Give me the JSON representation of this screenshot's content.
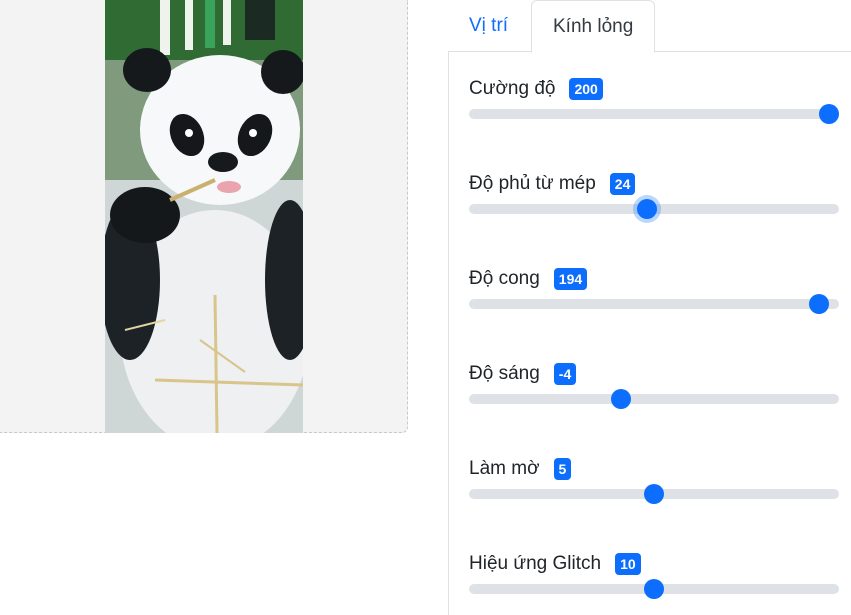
{
  "tabs": [
    {
      "label": "Vị trí",
      "active": false
    },
    {
      "label": "Kính lỏng",
      "active": true
    }
  ],
  "preview": {
    "image_icon": "panda-photo"
  },
  "sliders": [
    {
      "label": "Cường độ",
      "value": "200",
      "fraction": 1.0,
      "focused": false
    },
    {
      "label": "Độ phủ từ mép",
      "value": "24",
      "fraction": 0.48,
      "focused": true
    },
    {
      "label": "Độ cong",
      "value": "194",
      "fraction": 0.97,
      "focused": false
    },
    {
      "label": "Độ sáng",
      "value": "-4",
      "fraction": 0.405,
      "focused": false
    },
    {
      "label": "Làm mờ",
      "value": "5",
      "fraction": 0.5,
      "focused": false
    },
    {
      "label": "Hiệu ứng Glitch",
      "value": "10",
      "fraction": 0.5,
      "focused": false
    }
  ],
  "colors": {
    "accent": "#0d6efd",
    "track": "#dee2e6"
  }
}
